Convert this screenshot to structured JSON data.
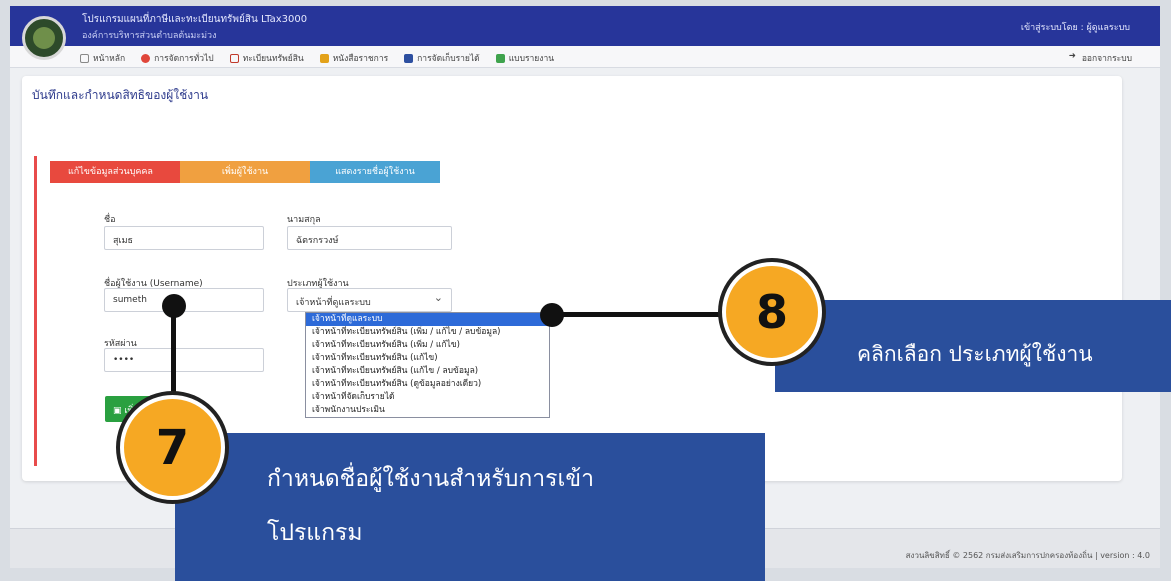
{
  "header": {
    "app_title": "โปรแกรมแผนที่ภาษีและทะเบียนทรัพย์สิน LTax3000",
    "org_name": "องค์การบริหารส่วนตำบลต้นมะม่วง",
    "login_user": "เข้าสู่ระบบโดย : ผู้ดูแลระบบ"
  },
  "menu": {
    "items": [
      {
        "label": "หน้าหลัก",
        "icon": "home-icon"
      },
      {
        "label": "การจัดการทั่วไป",
        "icon": "gear-icon"
      },
      {
        "label": "ทะเบียนทรัพย์สิน",
        "icon": "map-icon"
      },
      {
        "label": "หนังสือราชการ",
        "icon": "document-icon"
      },
      {
        "label": "การจัดเก็บรายได้",
        "icon": "calculator-icon"
      },
      {
        "label": "แบบรายงาน",
        "icon": "table-icon"
      }
    ],
    "logout_label": "ออกจากระบบ"
  },
  "page": {
    "title": "บันทึกและกำหนดสิทธิของผู้ใช้งาน",
    "tabs": [
      "แก้ไขข้อมูลส่วนบุคคล",
      "เพิ่มผู้ใช้งาน",
      "แสดงรายชื่อผู้ใช้งาน"
    ]
  },
  "form": {
    "first_name_label": "ชื่อ",
    "first_name_value": "สุเมธ",
    "last_name_label": "นามสกุล",
    "last_name_value": "ฉัตรกรวงษ์",
    "username_label": "ชื่อผู้ใช้งาน (Username)",
    "username_value": "sumeth",
    "user_type_label": "ประเภทผู้ใช้งาน",
    "user_type_value": "เจ้าหน้าที่ดูแลระบบ",
    "password_label": "รหัสผ่าน",
    "password_value": "••••",
    "save_label": "เพิ่มข้อมูล"
  },
  "dropdown": {
    "options": [
      "เจ้าหน้าที่ดูแลระบบ",
      "เจ้าหน้าที่ทะเบียนทรัพย์สิน (เพิ่ม / แก้ไข / ลบข้อมูล)",
      "เจ้าหน้าที่ทะเบียนทรัพย์สิน (เพิ่ม / แก้ไข)",
      "เจ้าหน้าที่ทะเบียนทรัพย์สิน (แก้ไข)",
      "เจ้าหน้าที่ทะเบียนทรัพย์สิน (แก้ไข / ลบข้อมูล)",
      "เจ้าหน้าที่ทะเบียนทรัพย์สิน (ดูข้อมูลอย่างเดียว)",
      "เจ้าหน้าที่จัดเก็บรายได้",
      "เจ้าพนักงานประเมิน"
    ]
  },
  "footer": {
    "text": "สงวนลิขสิทธิ์ © 2562 กรมส่งเสริมการปกครองท้องถิ่น | version : 4.0"
  },
  "annotations": {
    "step7_number": "7",
    "step7_text_line1": "กำหนดชื่อผู้ใช้งานสำหรับการเข้า",
    "step7_text_line2": "โปรแกรม",
    "step8_number": "8",
    "step8_text": "คลิกเลือก ประเภทผู้ใช้งาน"
  },
  "colors": {
    "header_bg": "#27359a",
    "callout_bg": "#2a4f9c",
    "badge": "#f6a823",
    "tab_red": "#e8493e",
    "tab_orange": "#f0a040",
    "tab_blue": "#4aa3d4",
    "save_green": "#2aa040"
  }
}
